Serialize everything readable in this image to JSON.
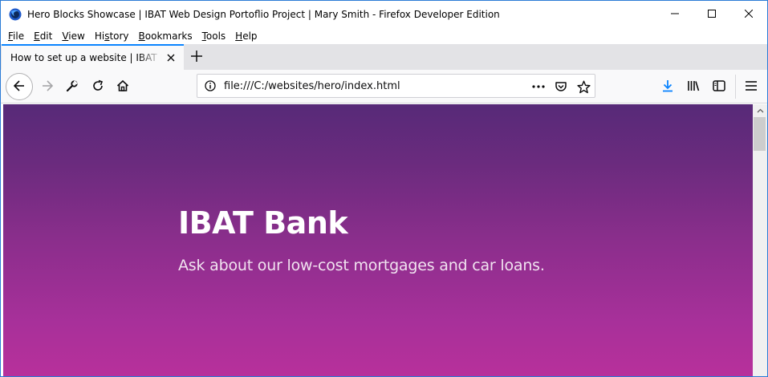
{
  "window": {
    "title": "Hero Blocks Showcase | IBAT Web Design Portoflio Project | Mary Smith - Firefox Developer Edition"
  },
  "menu": [
    {
      "pre": "",
      "u": "F",
      "post": "ile"
    },
    {
      "pre": "",
      "u": "E",
      "post": "dit"
    },
    {
      "pre": "",
      "u": "V",
      "post": "iew"
    },
    {
      "pre": "Hi",
      "u": "s",
      "post": "tory"
    },
    {
      "pre": "",
      "u": "B",
      "post": "ookmarks"
    },
    {
      "pre": "",
      "u": "T",
      "post": "ools"
    },
    {
      "pre": "",
      "u": "H",
      "post": "elp"
    }
  ],
  "tab": {
    "title": "How to set up a website | IBAT Portfolio"
  },
  "urlbar": {
    "url": "file:///C:/websites/hero/index.html"
  },
  "page": {
    "heading": "IBAT Bank",
    "subheading": "Ask about our low-cost mortgages and car loans."
  },
  "colors": {
    "accent": "#0a84ff",
    "hero_top": "#572a78",
    "hero_bottom": "#b8309b"
  },
  "icons": [
    "firefox-dev-icon",
    "minimize-icon",
    "maximize-icon",
    "close-icon",
    "tab-close-icon",
    "plus-icon",
    "back-arrow-icon",
    "forward-arrow-icon",
    "wrench-icon",
    "reload-icon",
    "home-icon",
    "info-icon",
    "ellipsis-icon",
    "pocket-icon",
    "star-icon",
    "download-icon",
    "library-icon",
    "sidebar-icon",
    "hamburger-menu-icon",
    "scroll-up-icon"
  ]
}
